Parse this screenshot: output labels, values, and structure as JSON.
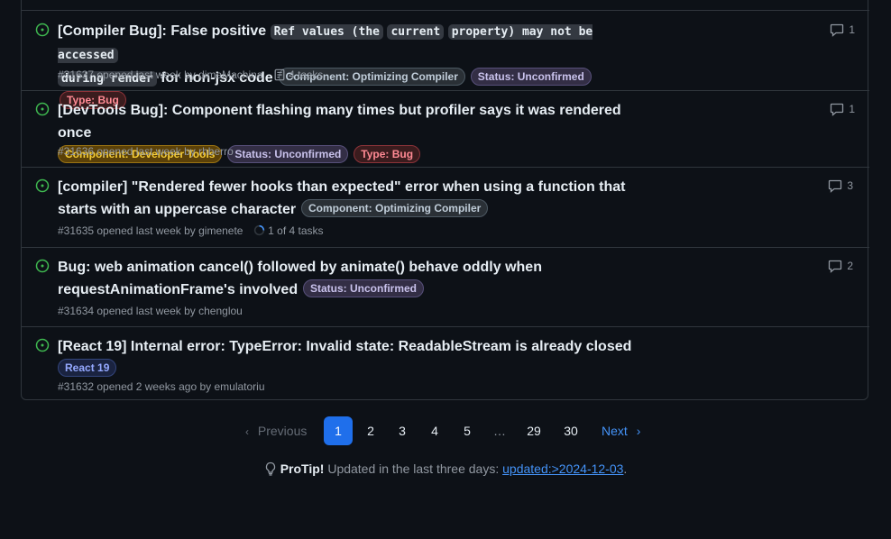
{
  "issues": [
    {
      "title_parts": [
        "[Compiler Bug]: False positive ",
        "Ref values (the",
        " ",
        "current",
        " ",
        "property) may not be accessed",
        " ",
        "during render",
        " for non-jsx code"
      ],
      "labels": [
        "Component: Optimizing Compiler",
        "Status: Unconfirmed",
        "Type: Bug"
      ],
      "meta": "#31637 opened last week by dimaMachina",
      "tasks": "4 tasks",
      "comments": "1"
    },
    {
      "title": "[DevTools Bug]: Component flashing many times but profiler says it was rendered once",
      "labels": [
        "Component: Developer Tools",
        "Status: Unconfirmed",
        "Type: Bug"
      ],
      "meta": "#31636 opened last week by rhberro",
      "comments": "1"
    },
    {
      "title": "[compiler] \"Rendered fewer hooks than expected\" error when using a function that starts with an uppercase character",
      "labels": [
        "Component: Optimizing Compiler"
      ],
      "meta": "#31635 opened last week by gimenete",
      "tasks": "1 of 4 tasks",
      "comments": "3"
    },
    {
      "title": "Bug: web animation cancel() followed by animate() behave oddly when requestAnimationFrame's involved",
      "labels": [
        "Status: Unconfirmed"
      ],
      "meta": "#31634 opened last week by chenglou",
      "comments": "2"
    },
    {
      "title": "[React 19] Internal error: TypeError: Invalid state: ReadableStream is already closed",
      "labels": [
        "React 19"
      ],
      "meta": "#31632 opened 2 weeks ago by emulatoriu"
    }
  ],
  "pagination": {
    "previous": "Previous",
    "pages": [
      "1",
      "2",
      "3",
      "4",
      "5",
      "…",
      "29",
      "30"
    ],
    "current": "1",
    "next": "Next"
  },
  "protip": {
    "label": "ProTip!",
    "text": " Updated in the last three days: ",
    "link": "updated:>2024-12-03",
    "end": "."
  },
  "colors": {
    "open_icon": "#3fb950",
    "accent": "#1f6feb",
    "link": "#4493f8"
  }
}
